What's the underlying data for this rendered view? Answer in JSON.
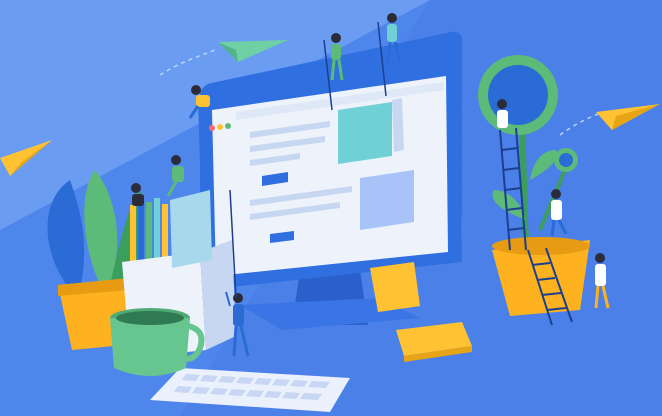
{
  "scene": {
    "kind": "illustration",
    "subject": "team-building-website",
    "colors": {
      "background": "#4f86ec",
      "background_light": "#6a9cf2",
      "monitor_frame": "#2f6fe0",
      "monitor_screen": "#eef3fb",
      "accent_teal": "#6fd0d6",
      "accent_yellow": "#ffc233",
      "accent_green": "#5dbb7a",
      "plant_pot": "#ffb21f",
      "mug": "#67c58f"
    },
    "icons": [
      "paper-plane-icon",
      "plant-icon",
      "ladder-icon",
      "mug-icon",
      "keyboard-icon",
      "monitor-icon",
      "pencil-cup-icon",
      "sticky-note-icon",
      "person-icon"
    ]
  }
}
